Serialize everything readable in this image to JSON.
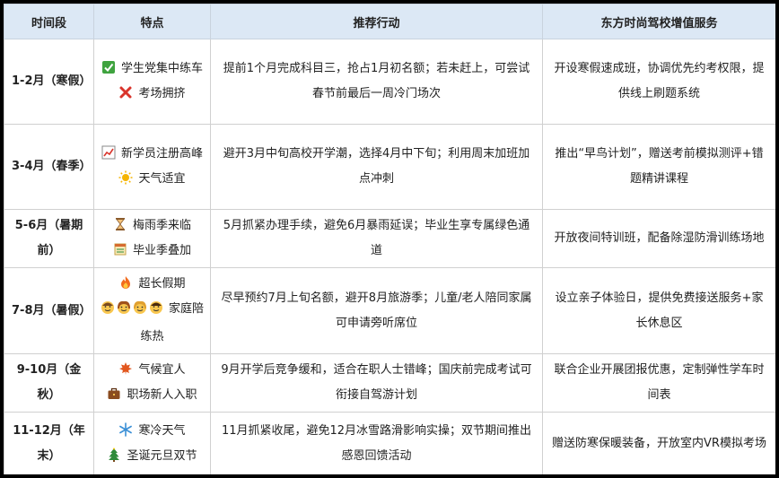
{
  "headers": [
    "时间段",
    "特点",
    "推荐行动",
    "东方时尚驾校增值服务"
  ],
  "rows": [
    {
      "period": "1-2月（寒假）",
      "features": [
        {
          "icon": "check-box-icon",
          "text": "学生党集中练车"
        },
        {
          "icon": "cross-mark-icon",
          "text": "考场拥挤"
        }
      ],
      "action": "提前1个月完成科目三，抢占1月初名额；若未赶上，可尝试春节前最后一周冷门场次",
      "service": "开设寒假速成班，协调优先约考权限，提供线上刷题系统"
    },
    {
      "period": "3-4月（春季）",
      "features": [
        {
          "icon": "chart-increasing-icon",
          "text": "新学员注册高峰"
        },
        {
          "icon": "sun-icon",
          "text": "天气适宜"
        }
      ],
      "action": "避开3月中旬高校开学潮，选择4月中下旬；利用周末加班加点冲刺",
      "service": "推出“早鸟计划”，赠送考前模拟测评+错题精讲课程"
    },
    {
      "period": "5-6月（暑期前）",
      "features": [
        {
          "icon": "hourglass-icon",
          "text": "梅雨季来临"
        },
        {
          "icon": "ledger-icon",
          "text": "毕业季叠加"
        }
      ],
      "action": "5月抓紧办理手续，避免6月暴雨延误；毕业生享专属绿色通道",
      "service": "开放夜间特训班，配备除湿防滑训练场地"
    },
    {
      "period": "7-8月（暑假）",
      "features": [
        {
          "icon": "fire-icon",
          "text": "超长假期"
        },
        {
          "icon": "family-faces-icon",
          "text": "家庭陪练热"
        }
      ],
      "action": "尽早预约7月上旬名额，避开8月旅游季；儿童/老人陪同家属可申请旁听席位",
      "service": "设立亲子体验日，提供免费接送服务+家长休息区"
    },
    {
      "period": "9-10月（金秋）",
      "features": [
        {
          "icon": "maple-leaf-icon",
          "text": "气候宜人"
        },
        {
          "icon": "briefcase-icon",
          "text": "职场新人入职"
        }
      ],
      "action": "9月开学后竞争缓和，适合在职人士错峰；国庆前完成考试可衔接自驾游计划",
      "service": "联合企业开展团报优惠，定制弹性学车时间表"
    },
    {
      "period": "11-12月（年末）",
      "features": [
        {
          "icon": "snowflake-icon",
          "text": "寒冷天气"
        },
        {
          "icon": "christmas-tree-icon",
          "text": "圣诞元旦双节"
        }
      ],
      "action": "11月抓紧收尾，避免12月冰雪路滑影响实操；双节期间推出感恩回馈活动",
      "service": "赠送防寒保暖装备，开放室内VR模拟考场"
    }
  ]
}
